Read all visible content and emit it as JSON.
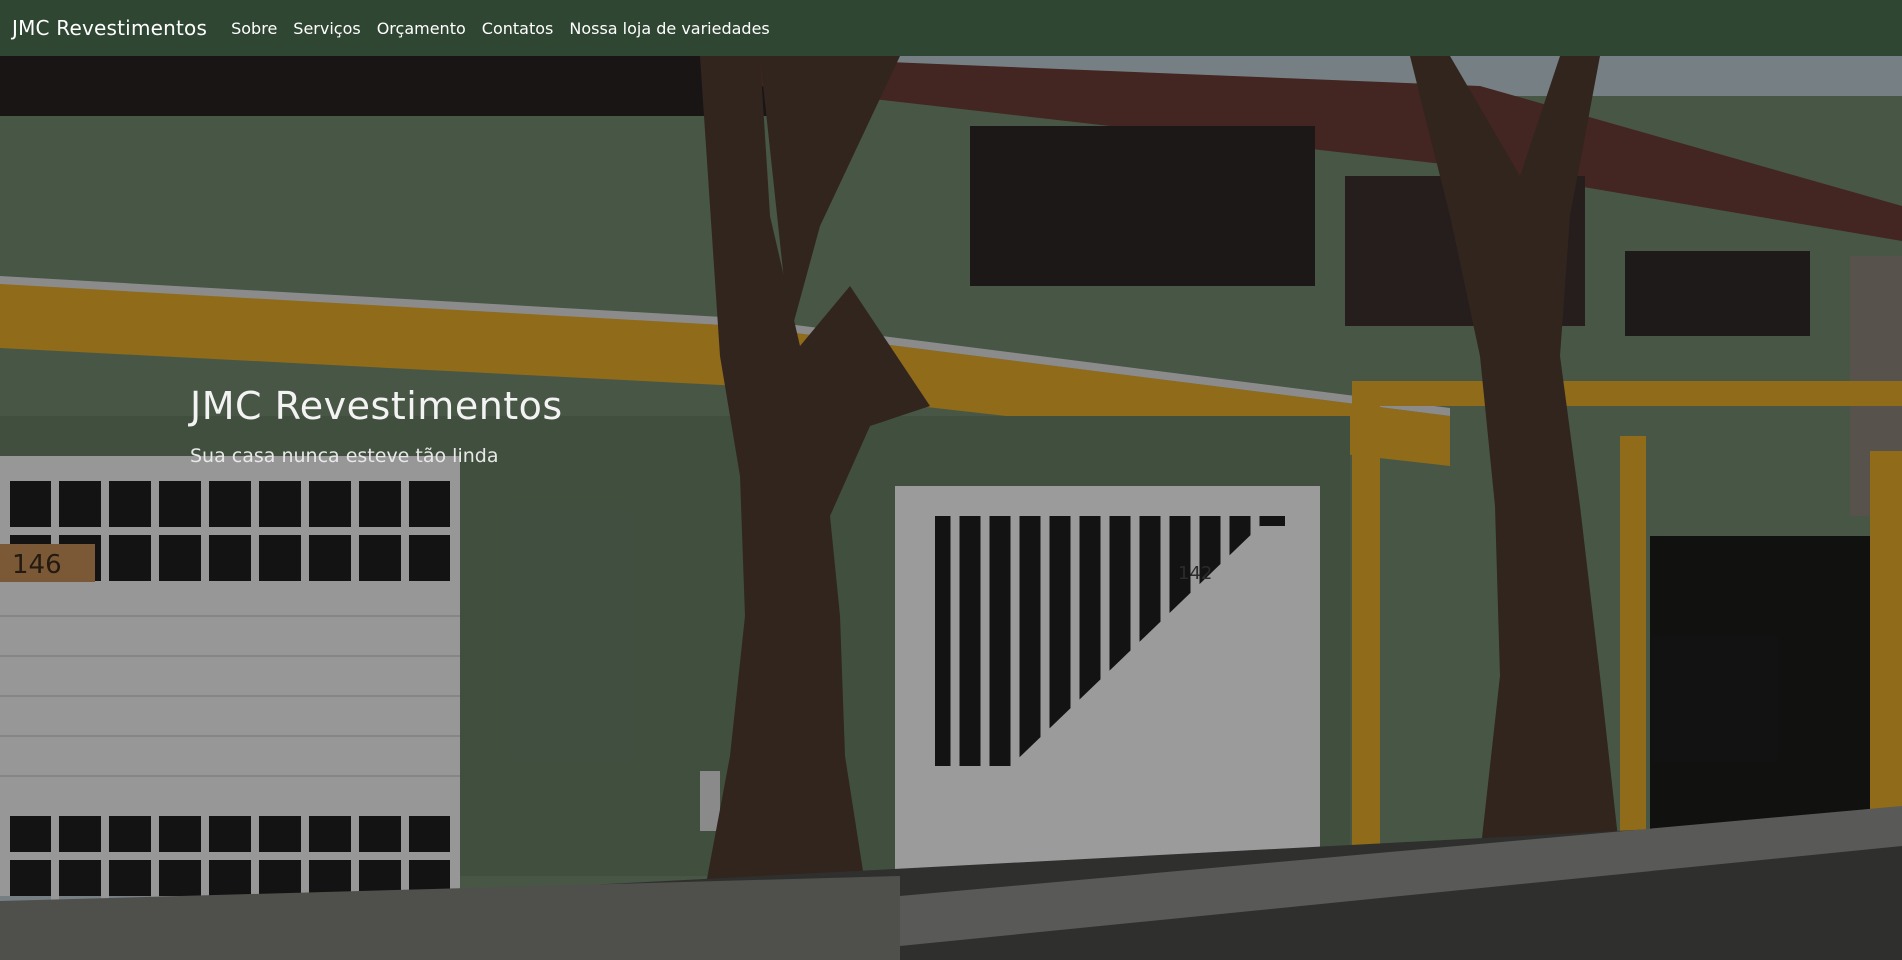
{
  "nav": {
    "brand": "JMC Revestimentos",
    "links": [
      "Sobre",
      "Serviços",
      "Orçamento",
      "Contatos",
      "Nossa loja de variedades"
    ]
  },
  "hero": {
    "title": "JMC Revestimentos",
    "subtitle": "Sua casa nunca esteve tão linda",
    "house_numbers": [
      "146",
      "142"
    ]
  },
  "colors": {
    "navbar": "#2f4632",
    "wall_green": "#6f876c",
    "trim_yellow": "#e0a82a",
    "gate_white": "#f2f2f2"
  }
}
